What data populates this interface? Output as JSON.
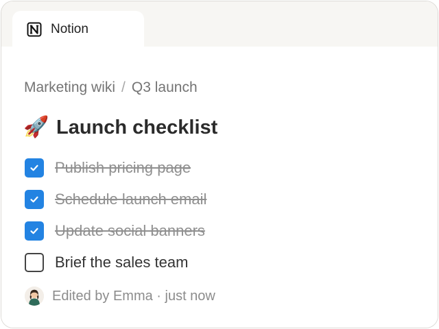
{
  "app": {
    "tab_title": "Notion",
    "tab_icon": "notion-logo-icon"
  },
  "breadcrumb": {
    "items": [
      "Marketing wiki",
      "Q3 launch"
    ],
    "separator": "/"
  },
  "page": {
    "emoji": "🚀",
    "title": "Launch checklist"
  },
  "todos": [
    {
      "label": "Publish pricing page",
      "checked": true
    },
    {
      "label": "Schedule launch email",
      "checked": true
    },
    {
      "label": "Update social banners",
      "checked": true
    },
    {
      "label": "Brief the sales team",
      "checked": false
    }
  ],
  "footer": {
    "edited_text": "Edited by Emma · just now",
    "avatar_icon": "user-avatar-icon"
  },
  "colors": {
    "accent": "#2383e2",
    "tabstrip_bg": "#f7f6f3"
  }
}
